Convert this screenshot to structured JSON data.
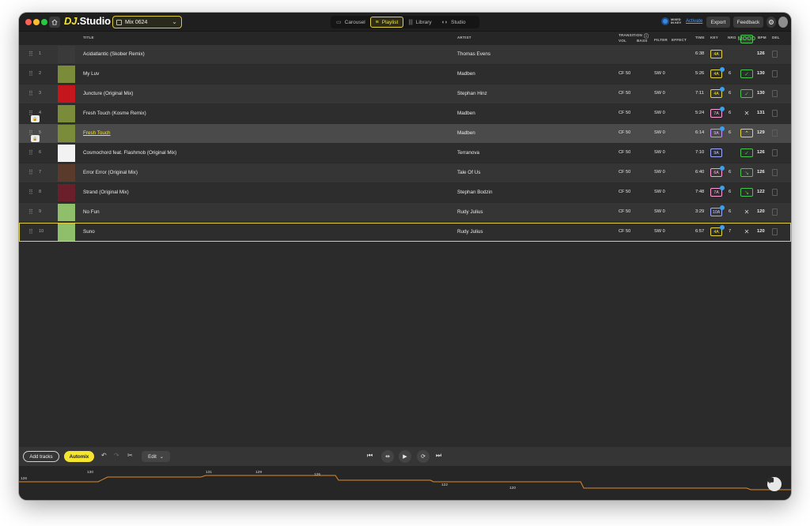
{
  "app": {
    "logo_prefix": "DJ",
    "logo_suffix": ".Studio",
    "mix_name": "Mix 0624"
  },
  "nav": {
    "tabs": [
      {
        "label": "Carousel",
        "icon": "carousel-icon",
        "active": false
      },
      {
        "label": "Playlist",
        "icon": "playlist-icon",
        "active": true
      },
      {
        "label": "Library",
        "icon": "library-icon",
        "active": false
      },
      {
        "label": "Studio",
        "icon": "studio-icon",
        "active": false
      }
    ]
  },
  "topright": {
    "mixedin_label": "MIXED IN KEY",
    "activate": "Activate",
    "export": "Export",
    "feedback": "Feedback"
  },
  "columns": {
    "title": "TITLE",
    "artist": "ARTIST",
    "transition": "TRANSITION",
    "vol": "VOL",
    "bass": "BASS",
    "filter": "FILTER",
    "effect": "EFFECT",
    "time": "TIME",
    "key": "KEY",
    "nrg": "NRG",
    "mood": "MOOD",
    "bpm": "BPM",
    "del": "DEL"
  },
  "tracks": [
    {
      "n": "1",
      "title": "Acidatlantic (Skober Remix)",
      "artist": "Thomas Evens",
      "vol": "",
      "bass": "",
      "time": "6:38",
      "key": "4A",
      "key_color": "yellow",
      "key_dot": false,
      "nrg": "",
      "mood": "",
      "bpm": "126",
      "art_color": "#3a3a3a"
    },
    {
      "n": "2",
      "title": "My Luv",
      "artist": "Madben",
      "vol": "CF 50",
      "bass": "SW 0",
      "time": "5:26",
      "key": "4A",
      "key_color": "yellow",
      "key_dot": true,
      "nrg": "6",
      "mood": "check",
      "bpm": "130",
      "art_color": "#7a8c3a"
    },
    {
      "n": "3",
      "title": "Juncture (Original Mix)",
      "artist": "Stephan Hinz",
      "vol": "CF 50",
      "bass": "SW 0",
      "time": "7:11",
      "key": "4A",
      "key_color": "yellow",
      "key_dot": true,
      "nrg": "6",
      "mood": "check",
      "bpm": "130",
      "art_color": "#c4161c"
    },
    {
      "n": "4",
      "title": "Fresh Touch (Kosme Remix)",
      "artist": "Madben",
      "vol": "CF 50",
      "bass": "SW 0",
      "time": "5:24",
      "key": "7A",
      "key_color": "pink",
      "key_dot": true,
      "nrg": "6",
      "mood": "x",
      "bpm": "131",
      "art_color": "#7a8c3a"
    },
    {
      "n": "5",
      "title": "Fresh Touch",
      "artist": "Madben",
      "vol": "CF 50",
      "bass": "SW 0",
      "time": "6:14",
      "key": "9A",
      "key_color": "purple",
      "key_dot": true,
      "nrg": "6",
      "mood": "up",
      "bpm": "129",
      "art_color": "#7a8c3a"
    },
    {
      "n": "6",
      "title": "Cosmochord feat. Flashmob (Original Mix)",
      "artist": "Terranova",
      "vol": "CF 50",
      "bass": "SW 0",
      "time": "7:10",
      "key": "9A",
      "key_color": "blue",
      "key_dot": false,
      "nrg": "",
      "mood": "check",
      "bpm": "126",
      "art_color": "#f2f2f2"
    },
    {
      "n": "7",
      "title": "Error Error (Original Mix)",
      "artist": "Tale Of Us",
      "vol": "CF 50",
      "bass": "SW 0",
      "time": "6:40",
      "key": "6A",
      "key_color": "pink",
      "key_dot": true,
      "nrg": "6",
      "mood": "down",
      "bpm": "126",
      "art_color": "#5a3a2a"
    },
    {
      "n": "8",
      "title": "Strand (Original Mix)",
      "artist": "Stephan Bodzin",
      "vol": "CF 50",
      "bass": "SW 0",
      "time": "7:48",
      "key": "7A",
      "key_color": "pink",
      "key_dot": true,
      "nrg": "6",
      "mood": "down",
      "bpm": "122",
      "art_color": "#6a1f2a"
    },
    {
      "n": "9",
      "title": "No Fun",
      "artist": "Rudy Julius",
      "vol": "CF 50",
      "bass": "SW 0",
      "time": "3:29",
      "key": "10A",
      "key_color": "blue",
      "key_dot": true,
      "nrg": "6",
      "mood": "x",
      "bpm": "120",
      "art_color": "#8fbf6a"
    },
    {
      "n": "10",
      "title": "Suno",
      "artist": "Rudy Julius",
      "vol": "CF 50",
      "bass": "SW 0",
      "time": "6:57",
      "key": "4A",
      "key_color": "yellow",
      "key_dot": true,
      "nrg": "7",
      "mood": "x",
      "bpm": "120",
      "art_color": "#8fbf6a"
    }
  ],
  "bottom": {
    "add_tracks": "Add tracks",
    "automix": "Automix",
    "edit": "Edit"
  },
  "lane": {
    "bpm_labels": [
      "126",
      "130",
      "131",
      "129",
      "126",
      "122",
      "120"
    ]
  },
  "colors": {
    "accent": "#f5e52e",
    "lane_line": "#e08a2a"
  }
}
